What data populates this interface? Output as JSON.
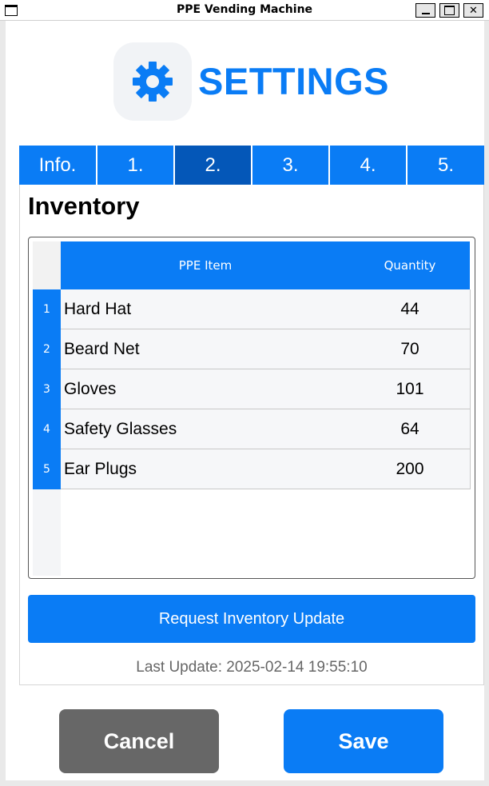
{
  "window": {
    "title": "PPE Vending Machine",
    "minimize_icon": "minimize-icon",
    "maximize_icon": "maximize-icon",
    "close_label": "✕"
  },
  "header": {
    "icon": "gear-icon",
    "title": "SETTINGS",
    "accent_color": "#0a7cf5"
  },
  "tabs": [
    {
      "label": "Info.",
      "active": false
    },
    {
      "label": "1.",
      "active": false
    },
    {
      "label": "2.",
      "active": true
    },
    {
      "label": "3.",
      "active": false
    },
    {
      "label": "4.",
      "active": false
    },
    {
      "label": "5.",
      "active": false
    }
  ],
  "inventory": {
    "title": "Inventory",
    "columns": [
      "PPE Item",
      "Quantity"
    ],
    "rows": [
      {
        "num": "1",
        "item": "Hard Hat",
        "quantity": "44"
      },
      {
        "num": "2",
        "item": "Beard Net",
        "quantity": "70"
      },
      {
        "num": "3",
        "item": "Gloves",
        "quantity": "101"
      },
      {
        "num": "4",
        "item": "Safety Glasses",
        "quantity": "64"
      },
      {
        "num": "5",
        "item": "Ear Plugs",
        "quantity": "200"
      }
    ],
    "request_button": "Request Inventory Update",
    "last_update": "Last Update: 2025-02-14 19:55:10"
  },
  "actions": {
    "cancel": "Cancel",
    "save": "Save",
    "cancel_color": "#676767",
    "save_color": "#0a7cf5"
  }
}
